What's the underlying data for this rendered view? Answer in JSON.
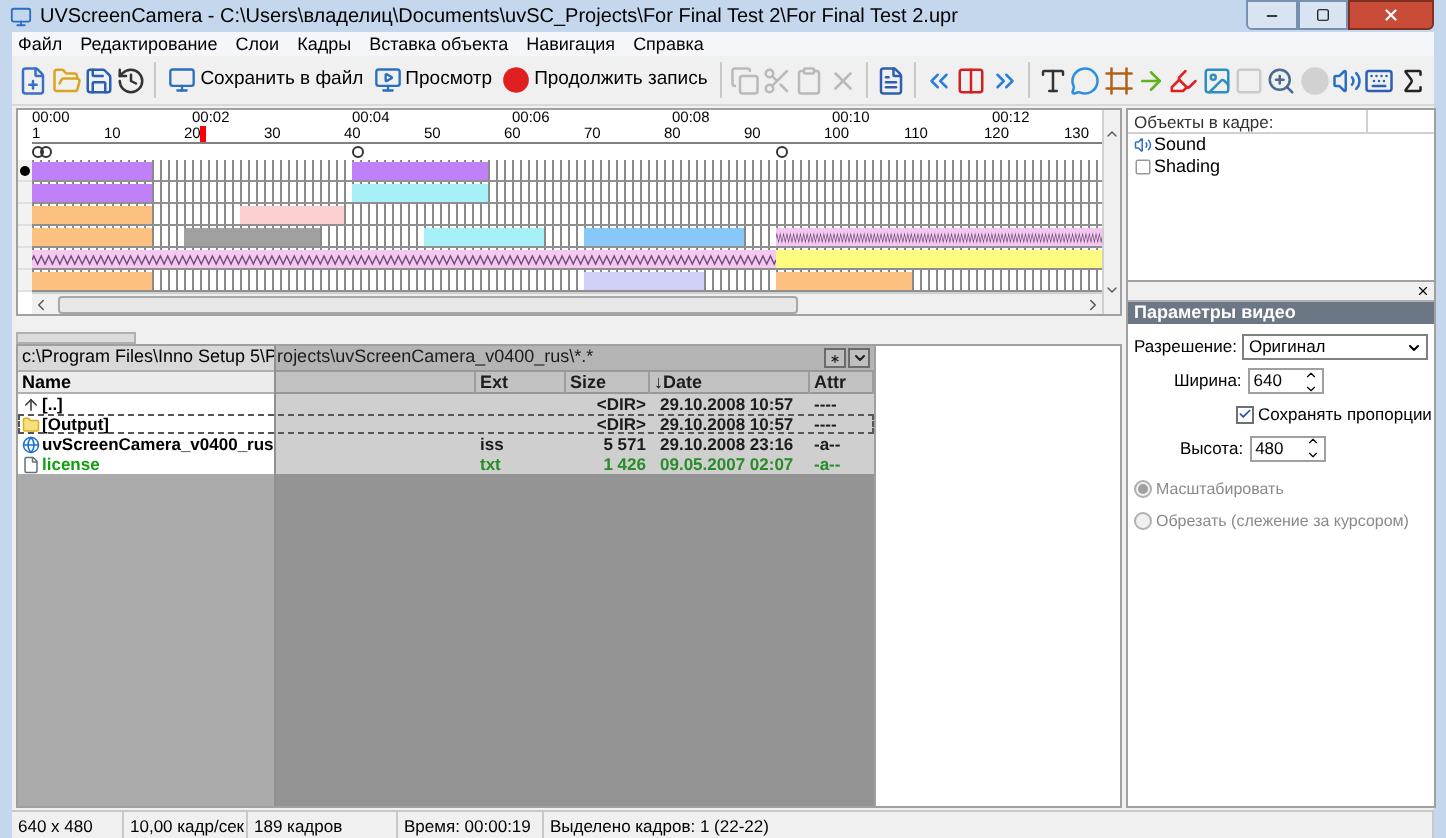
{
  "window": {
    "title": "UVScreenCamera - C:\\Users\\владелиц\\Documents\\uvSC_Projects\\For Final Test 2\\For Final Test 2.upr"
  },
  "menu": [
    "Файл",
    "Редактирование",
    "Слои",
    "Кадры",
    "Вставка объекта",
    "Навигация",
    "Справка"
  ],
  "toolbar": [
    {
      "kind": "icon",
      "disabled": false
    },
    {
      "kind": "icon",
      "disabled": false
    },
    {
      "kind": "icon",
      "disabled": false
    },
    {
      "kind": "icon",
      "disabled": false
    },
    {
      "kind": "separator"
    },
    {
      "kind": "button",
      "label": "Сохранить в файл",
      "disabled": false
    },
    {
      "kind": "button",
      "label": "Просмотр",
      "disabled": false
    },
    {
      "kind": "button",
      "label": "Продолжить запись",
      "disabled": false
    },
    {
      "kind": "separator"
    },
    {
      "kind": "icon",
      "disabled": true
    },
    {
      "kind": "icon",
      "disabled": true
    },
    {
      "kind": "icon",
      "disabled": true
    },
    {
      "kind": "icon",
      "disabled": true
    },
    {
      "kind": "separator"
    },
    {
      "kind": "icon",
      "disabled": false
    },
    {
      "kind": "separator"
    },
    {
      "kind": "icon",
      "disabled": false
    },
    {
      "kind": "icon",
      "disabled": false
    },
    {
      "kind": "icon",
      "disabled": false
    },
    {
      "kind": "separator"
    },
    {
      "kind": "icon",
      "disabled": false
    },
    {
      "kind": "icon",
      "disabled": false
    },
    {
      "kind": "icon",
      "disabled": false
    },
    {
      "kind": "icon",
      "disabled": false
    },
    {
      "kind": "icon",
      "disabled": false
    },
    {
      "kind": "icon",
      "disabled": false
    },
    {
      "kind": "icon",
      "disabled": true
    },
    {
      "kind": "icon",
      "disabled": false
    },
    {
      "kind": "icon",
      "disabled": true
    },
    {
      "kind": "icon",
      "disabled": false
    },
    {
      "kind": "icon",
      "disabled": false
    },
    {
      "kind": "icon",
      "disabled": false
    }
  ],
  "timeline": {
    "time_labels": [
      "00:00",
      "00:02",
      "00:04",
      "00:06",
      "00:08",
      "00:10",
      "00:12"
    ],
    "frame_labels": [
      "1",
      "10",
      "20",
      "30",
      "40",
      "50",
      "60",
      "70",
      "80",
      "90",
      "100",
      "110",
      "120",
      "130"
    ],
    "tracks": [
      {
        "selected": true,
        "clips": [
          {
            "kind": "block",
            "color": "#c080f8"
          },
          {
            "kind": "block",
            "color": "#c080f8"
          }
        ]
      },
      {
        "selected": false,
        "clips": [
          {
            "kind": "block",
            "color": "#c080f8"
          },
          {
            "kind": "block",
            "color": "#a8f0f8"
          }
        ]
      },
      {
        "selected": false,
        "clips": [
          {
            "kind": "block",
            "color": "#fcc080"
          },
          {
            "kind": "block",
            "color": "#fcd0d0"
          }
        ]
      },
      {
        "selected": false,
        "clips": [
          {
            "kind": "block",
            "color": "#fcc080"
          },
          {
            "kind": "block",
            "color": "#a0a0a0"
          },
          {
            "kind": "block",
            "color": "#a8f0f8"
          },
          {
            "kind": "block",
            "color": "#88c8f8"
          },
          {
            "kind": "wave",
            "color": "#f4c8f0"
          }
        ]
      },
      {
        "selected": false,
        "clips": [
          {
            "kind": "wave",
            "color": "#f4c8f0"
          },
          {
            "kind": "block",
            "color": "#fcfc80"
          }
        ]
      },
      {
        "selected": false,
        "clips": [
          {
            "kind": "block",
            "color": "#fcc080"
          },
          {
            "kind": "block",
            "color": "#d0d0f8"
          },
          {
            "kind": "block",
            "color": "#fcc080"
          }
        ]
      }
    ]
  },
  "file_panel": {
    "path": "c:\\Program Files\\Inno Setup 5\\Projects\\uvScreenCamera_v0400_rus\\*.*",
    "columns": [
      "Name",
      "Ext",
      "Size",
      "↓Date",
      "Attr"
    ],
    "rows": [
      {
        "kind": "up",
        "name": "[..]",
        "size": "<DIR>",
        "date": "29.10.2008 10:57",
        "attr": "----",
        "focused": false,
        "color": "#000000"
      },
      {
        "kind": "folder",
        "name": "[Output]",
        "size": "<DIR>",
        "date": "29.10.2008 10:57",
        "attr": "----",
        "focused": true,
        "color": "#000000"
      },
      {
        "kind": "script",
        "name": "uvScreenCamera_v0400_rus",
        "ext": "iss",
        "size": "5 571",
        "date": "29.10.2008 23:16",
        "attr": "-a--",
        "focused": false,
        "color": "#000000"
      },
      {
        "kind": "text",
        "name": "license",
        "ext": "txt",
        "size": "1 426",
        "date": "09.05.2007 02:07",
        "attr": "-a--",
        "focused": false,
        "color": "#10a010"
      }
    ]
  },
  "objects_panel": {
    "title": "Объекты в кадре:",
    "items": [
      {
        "kind": "sound",
        "label": "Sound"
      },
      {
        "kind": "shading",
        "label": "Shading"
      }
    ]
  },
  "video_params": {
    "title": "Параметры видео",
    "resolution": {
      "label": "Разрешение:",
      "value": "Оригинал"
    },
    "width": {
      "label": "Ширина:",
      "value": "640"
    },
    "keep_ratio": {
      "label": "Сохранять пропорции",
      "checked": true
    },
    "height": {
      "label": "Высота:",
      "value": "480"
    },
    "modes": [
      {
        "label": "Масштабировать",
        "selected": true,
        "disabled": true
      },
      {
        "label": "Обрезать (слежение за курсором)",
        "selected": false,
        "disabled": true
      }
    ]
  },
  "status_bar": [
    "640 x 480",
    "10,00 кадр/сек",
    "189 кадров",
    "Время: 00:00:19",
    "Выделено кадров: 1 (22-22)"
  ]
}
